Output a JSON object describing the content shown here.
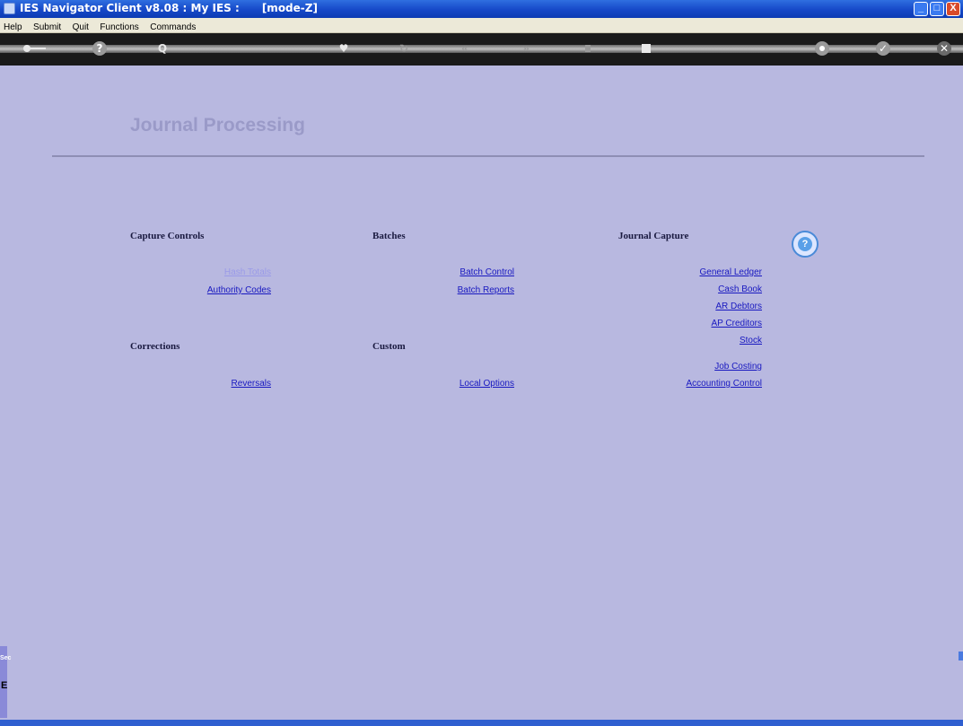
{
  "window": {
    "title": "IES Navigator Client v8.08 : My IES :      [mode-Z]",
    "minimize_glyph": "_",
    "maximize_glyph": "□",
    "close_glyph": "X"
  },
  "menubar": {
    "items": [
      "Help",
      "Submit",
      "Quit",
      "Functions",
      "Commands"
    ]
  },
  "toolbar": {
    "icons": [
      "key-icon",
      "help-icon",
      "search-icon",
      "heart-icon",
      "refresh-icon",
      "back-icon",
      "forward-icon",
      "up-icon",
      "stop-icon",
      "gear-icon",
      "check-icon",
      "close-icon"
    ],
    "glyphs": {
      "help": "?",
      "search": "Q",
      "heart": "♥",
      "refresh": "↻",
      "back": "«",
      "forward": "»",
      "check": "✓",
      "close": "✕"
    }
  },
  "page": {
    "title": "Journal Processing"
  },
  "sections": {
    "capture_controls": {
      "heading": "Capture Controls",
      "links": [
        "Hash Totals",
        "Authority Codes"
      ]
    },
    "corrections": {
      "heading": "Corrections",
      "links": [
        "Reversals"
      ]
    },
    "batches": {
      "heading": "Batches",
      "links": [
        "Batch Control",
        "Batch Reports"
      ]
    },
    "custom": {
      "heading": "Custom",
      "links": [
        "Local Options"
      ]
    },
    "journal_capture": {
      "heading": "Journal Capture",
      "links": [
        "General Ledger",
        "Cash Book",
        "AR Debtors",
        "AP Creditors",
        "Stock",
        "Job Costing",
        "Accounting Control"
      ]
    }
  },
  "side_panel": {
    "label": "Sec",
    "value": "E"
  },
  "colors": {
    "background": "#b8b8e0",
    "link": "#1818c0",
    "link_disabled": "#9a9ae8",
    "title": "#9a9ac8"
  }
}
